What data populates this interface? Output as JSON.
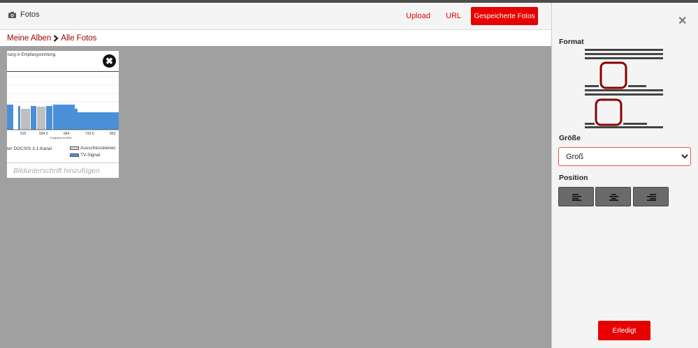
{
  "header": {
    "title": "Fotos",
    "upload_label": "Upload",
    "url_label": "URL",
    "saved_photos_label": "Gespeicherte Fotos"
  },
  "breadcrumb": {
    "albums_label": "Meine Alben",
    "all_photos_label": "Alle Fotos"
  },
  "photo": {
    "header_text": "tung in Empfangsrichtung.",
    "x_tick_labels": [
      "525",
      "594.5",
      "664",
      "733.5",
      "803"
    ],
    "x_axis_label": "Frequenz in MHz",
    "legend": {
      "docsis_label": "ter DOCSIS 3.1-Kanal",
      "exclusion_label": "Ausschlussbereic",
      "tv_label": "TV-Signal"
    },
    "caption_placeholder": "Bildunterschrift hinzufügen"
  },
  "sidebar": {
    "format_heading": "Format",
    "size_heading": "Größe",
    "size_selected": "Groß",
    "position_heading": "Position",
    "done_label": "Erledigt"
  },
  "icons": {
    "camera": "camera-icon",
    "close_photo": "close-circle-icon",
    "close_panel": "close-icon",
    "align_left": "align-left-icon",
    "align_center": "align-center-icon",
    "align_right": "align-right-icon"
  },
  "colors": {
    "accent": "#e60000",
    "breadcrumb": "#9a0000",
    "gallery_bg": "#a0a0a0",
    "frame_red": "#8b0000",
    "tv_signal": "#4a90d9"
  }
}
